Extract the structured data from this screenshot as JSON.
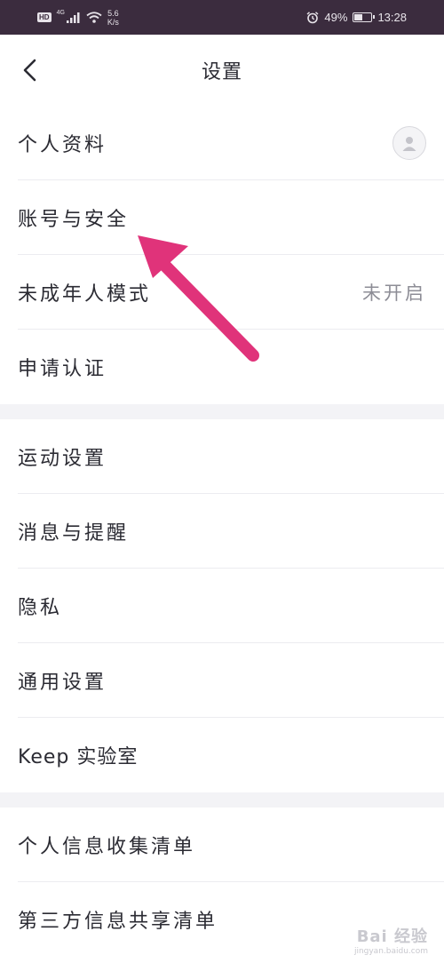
{
  "status_bar": {
    "hd": "HD",
    "network": "4G",
    "speed_value": "5.6",
    "speed_unit": "K/s",
    "battery_percent": "49%",
    "battery_level": 0.49,
    "time": "13:28"
  },
  "header": {
    "title": "设置"
  },
  "sections": [
    {
      "items": [
        {
          "label": "个人资料"
        },
        {
          "label": "账号与安全"
        },
        {
          "label": "未成年人模式",
          "value": "未开启"
        },
        {
          "label": "申请认证"
        }
      ]
    },
    {
      "items": [
        {
          "label": "运动设置"
        },
        {
          "label": "消息与提醒"
        },
        {
          "label": "隐私"
        },
        {
          "label": "通用设置"
        },
        {
          "label": "Keep 实验室"
        }
      ]
    },
    {
      "items": [
        {
          "label": "个人信息收集清单"
        },
        {
          "label": "第三方信息共享清单"
        }
      ]
    }
  ],
  "watermark": {
    "brand": "Bai 经验",
    "url": "jingyan.baidu.com"
  },
  "colors": {
    "status_bar": "#3b2c3e",
    "annotation_arrow": "#e0337a",
    "divider": "#ececf0",
    "section_gap": "#f3f3f6"
  }
}
